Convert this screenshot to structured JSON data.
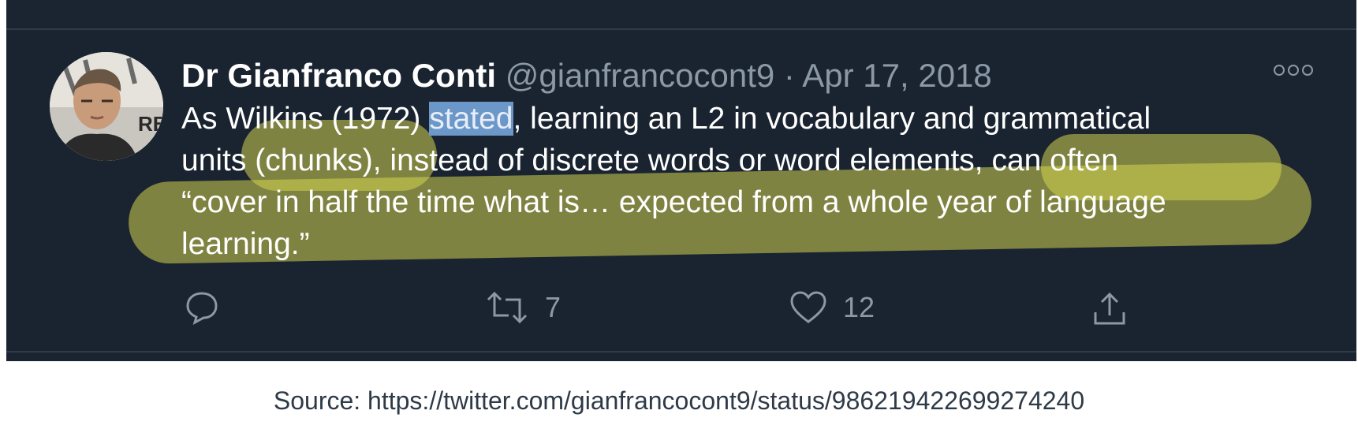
{
  "tweet": {
    "author_name": "Dr Gianfranco Conti",
    "handle": "@gianfrancocont9",
    "separator": "·",
    "date": "Apr 17, 2018",
    "avatar_label": "RB",
    "text": {
      "line1_a": "As Wilkins (1972) ",
      "line1_selected": "stated",
      "line1_b": ", learning an L2 in vocabulary and grammatical",
      "line2": "units (chunks), instead of discrete words or word elements, can often",
      "line3": "“cover in half the time what is… expected from a whole year of language",
      "line4": "learning.”"
    },
    "actions": {
      "reply_count": "",
      "retweet_count": "7",
      "like_count": "12"
    }
  },
  "source_caption": "Source: https://twitter.com/gianfrancocont9/status/986219422699274240",
  "colors": {
    "card_background": "#1a2330",
    "highlight": "#d4d450",
    "selection": "#6b97c9",
    "muted_text": "#8b98a5"
  },
  "icons": [
    "reply-icon",
    "retweet-icon",
    "like-icon",
    "share-icon",
    "more-icon"
  ]
}
